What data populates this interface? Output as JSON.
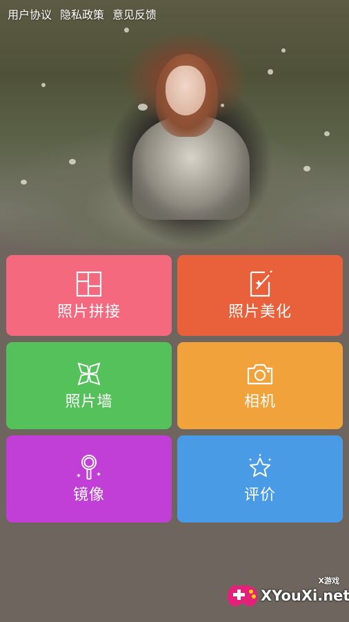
{
  "top_links": {
    "user_agreement": "用户协议",
    "privacy_policy": "隐私政策",
    "feedback": "意见反馈"
  },
  "tiles": {
    "collage": {
      "label": "照片拼接",
      "icon": "collage-grid-icon",
      "color": "#f4697e"
    },
    "beautify": {
      "label": "照片美化",
      "icon": "magic-wand-photo-icon",
      "color": "#e8613a"
    },
    "wall": {
      "label": "照片墙",
      "icon": "photo-wall-icon",
      "color": "#55c15a"
    },
    "camera": {
      "label": "相机",
      "icon": "camera-icon",
      "color": "#f2a23a"
    },
    "mirror": {
      "label": "镜像",
      "icon": "hand-mirror-icon",
      "color": "#c23fd7"
    },
    "rate": {
      "label": "评价",
      "icon": "star-icon",
      "color": "#4a9be6"
    }
  },
  "watermark": {
    "tag": "X游戏",
    "site": "XYouXi.net"
  }
}
